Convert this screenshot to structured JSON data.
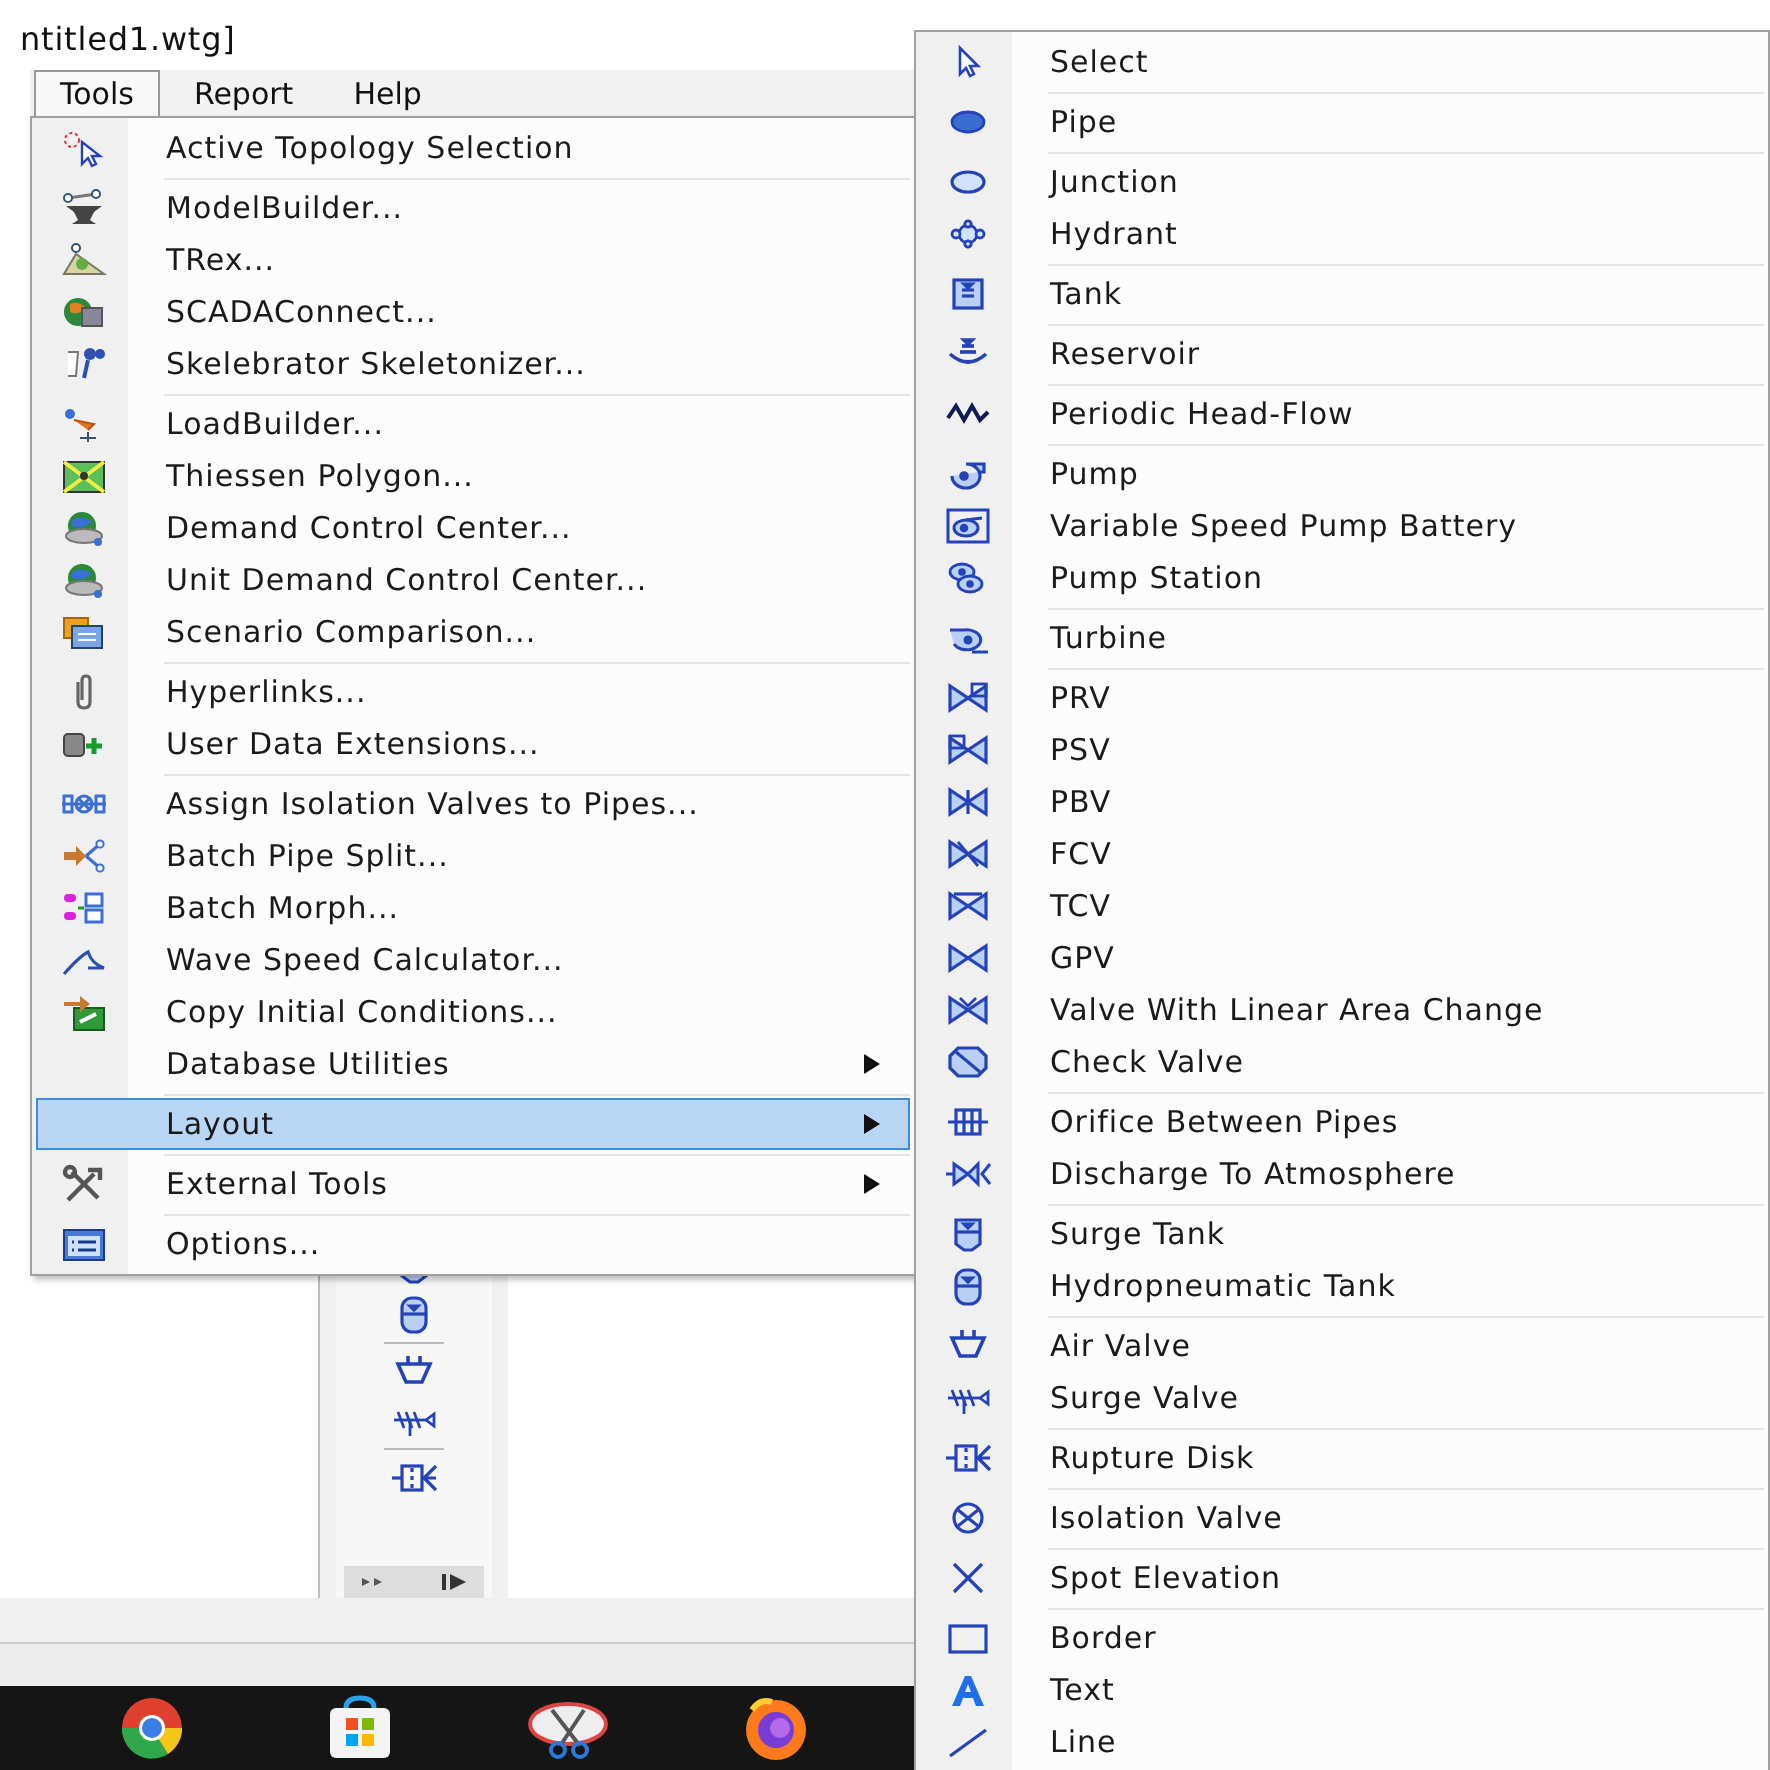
{
  "window": {
    "title": "ntitled1.wtg]"
  },
  "menu_bar": [
    {
      "label": "Tools",
      "selected": true
    },
    {
      "label": "Report",
      "selected": false
    },
    {
      "label": "Help",
      "selected": false
    }
  ],
  "tools_menu": {
    "groups": [
      [
        {
          "label": "Active Topology Selection",
          "has_submenu": false,
          "selected": false
        }
      ],
      [
        {
          "label": "ModelBuilder...",
          "has_submenu": false,
          "selected": false
        },
        {
          "label": "TRex...",
          "has_submenu": false,
          "selected": false
        },
        {
          "label": "SCADAConnect...",
          "has_submenu": false,
          "selected": false
        },
        {
          "label": "Skelebrator Skeletonizer...",
          "has_submenu": false,
          "selected": false
        }
      ],
      [
        {
          "label": "LoadBuilder...",
          "has_submenu": false,
          "selected": false
        },
        {
          "label": "Thiessen Polygon...",
          "has_submenu": false,
          "selected": false
        },
        {
          "label": "Demand Control Center...",
          "has_submenu": false,
          "selected": false
        },
        {
          "label": "Unit Demand Control Center...",
          "has_submenu": false,
          "selected": false
        },
        {
          "label": "Scenario Comparison...",
          "has_submenu": false,
          "selected": false
        }
      ],
      [
        {
          "label": "Hyperlinks...",
          "has_submenu": false,
          "selected": false
        },
        {
          "label": "User Data Extensions...",
          "has_submenu": false,
          "selected": false
        }
      ],
      [
        {
          "label": "Assign Isolation Valves to Pipes...",
          "has_submenu": false,
          "selected": false
        },
        {
          "label": "Batch Pipe Split...",
          "has_submenu": false,
          "selected": false
        },
        {
          "label": "Batch Morph...",
          "has_submenu": false,
          "selected": false
        },
        {
          "label": "Wave Speed Calculator...",
          "has_submenu": false,
          "selected": false
        },
        {
          "label": "Copy Initial Conditions...",
          "has_submenu": false,
          "selected": false
        },
        {
          "label": "Database Utilities",
          "has_submenu": true,
          "selected": false
        }
      ],
      [
        {
          "label": "Layout",
          "has_submenu": true,
          "selected": true
        }
      ],
      [
        {
          "label": "External Tools",
          "has_submenu": true,
          "selected": false
        }
      ],
      [
        {
          "label": "Options...",
          "has_submenu": false,
          "selected": false
        }
      ]
    ]
  },
  "layout_submenu": {
    "groups": [
      [
        {
          "label": "Select"
        }
      ],
      [
        {
          "label": "Pipe"
        }
      ],
      [
        {
          "label": "Junction"
        },
        {
          "label": "Hydrant"
        }
      ],
      [
        {
          "label": "Tank"
        }
      ],
      [
        {
          "label": "Reservoir"
        }
      ],
      [
        {
          "label": "Periodic Head-Flow"
        }
      ],
      [
        {
          "label": "Pump"
        },
        {
          "label": "Variable Speed Pump Battery"
        },
        {
          "label": "Pump Station"
        }
      ],
      [
        {
          "label": "Turbine"
        }
      ],
      [
        {
          "label": "PRV"
        },
        {
          "label": "PSV"
        },
        {
          "label": "PBV"
        },
        {
          "label": "FCV"
        },
        {
          "label": "TCV"
        },
        {
          "label": "GPV"
        },
        {
          "label": "Valve With Linear Area Change"
        },
        {
          "label": "Check Valve"
        }
      ],
      [
        {
          "label": "Orifice Between Pipes"
        },
        {
          "label": "Discharge To Atmosphere"
        }
      ],
      [
        {
          "label": "Surge Tank"
        },
        {
          "label": "Hydropneumatic Tank"
        }
      ],
      [
        {
          "label": "Air Valve"
        },
        {
          "label": "Surge Valve"
        }
      ],
      [
        {
          "label": "Rupture Disk"
        }
      ],
      [
        {
          "label": "Isolation Valve"
        }
      ],
      [
        {
          "label": "Spot Elevation"
        }
      ],
      [
        {
          "label": "Border"
        },
        {
          "label": "Text"
        },
        {
          "label": "Line"
        }
      ]
    ]
  }
}
